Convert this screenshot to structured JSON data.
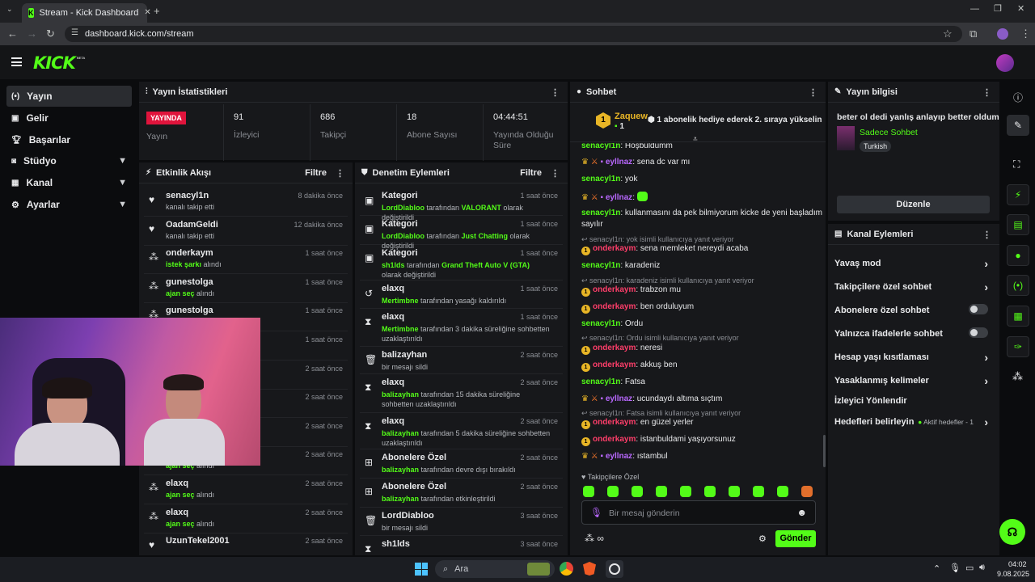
{
  "browser": {
    "tab_title": "Stream - Kick Dashboard",
    "url": "dashboard.kick.com/stream"
  },
  "brand": {
    "logo": "KICK",
    "beta": "BETA",
    "accent": "#53fc18"
  },
  "nav": [
    {
      "label": "Yayın",
      "icon": "broadcast-icon"
    },
    {
      "label": "Gelir",
      "icon": "income-icon"
    },
    {
      "label": "Başarılar",
      "icon": "trophy-icon"
    },
    {
      "label": "Stüdyo",
      "icon": "studio-icon"
    },
    {
      "label": "Kanal",
      "icon": "channel-icon"
    },
    {
      "label": "Ayarlar",
      "icon": "gear-icon"
    }
  ],
  "stats": {
    "title": "Yayın İstatistikleri",
    "live_badge": "YAYINDA",
    "live_label": "Yayın",
    "items": [
      {
        "value": "91",
        "label": "İzleyici"
      },
      {
        "value": "686",
        "label": "Takipçi"
      },
      {
        "value": "18",
        "label": "Abone Sayısı"
      },
      {
        "value": "04:44:51",
        "label": "Yayında Olduğu Süre"
      }
    ]
  },
  "activity": {
    "title": "Etkinlik Akışı",
    "filter": "Filtre",
    "rows": [
      {
        "name": "senacyl1n",
        "pre": "",
        "hl": "",
        "post": "kanalı takip etti",
        "time": "8 dakika önce"
      },
      {
        "name": "OadamGeldi",
        "pre": "",
        "hl": "",
        "post": "kanalı takip etti",
        "time": "12 dakika önce"
      },
      {
        "name": "onderkaym",
        "pre": "",
        "hl": "istek şarkı",
        "post": " alındı",
        "time": "1 saat önce"
      },
      {
        "name": "gunestolga",
        "pre": "",
        "hl": "ajan seç",
        "post": " alındı",
        "time": "1 saat önce"
      },
      {
        "name": "gunestolga",
        "pre": "",
        "hl": "",
        "post": "",
        "time": "1 saat önce"
      },
      {
        "name": "",
        "pre": "",
        "hl": "",
        "post": "",
        "time": "1 saat önce"
      },
      {
        "name": "",
        "pre": "",
        "hl": "",
        "post": "",
        "time": "2 saat önce"
      },
      {
        "name": "",
        "pre": "",
        "hl": "",
        "post": "",
        "time": "2 saat önce"
      },
      {
        "name": "",
        "pre": "",
        "hl": "",
        "post": "",
        "time": "2 saat önce"
      },
      {
        "name": "",
        "pre": "",
        "hl": "ajan seç",
        "post": " alındı",
        "time": "2 saat önce"
      },
      {
        "name": "elaxq",
        "pre": "",
        "hl": "ajan seç",
        "post": " alındı",
        "time": "2 saat önce"
      },
      {
        "name": "elaxq",
        "pre": "",
        "hl": "ajan seç",
        "post": " alındı",
        "time": "2 saat önce"
      },
      {
        "name": "UzunTekel2001",
        "pre": "",
        "hl": "",
        "post": "",
        "time": "2 saat önce"
      }
    ]
  },
  "moderation": {
    "title": "Denetim Eylemleri",
    "filter": "Filtre",
    "rows": [
      {
        "name": "Kategori",
        "u": "LordDiabloo",
        "mid": " tarafından ",
        "hl": "VALORANT",
        "post": " olarak değiştirildi",
        "time": "1 saat önce"
      },
      {
        "name": "Kategori",
        "u": "LordDiabloo",
        "mid": " tarafından ",
        "hl": "Just Chatting",
        "post": " olarak değiştirildi",
        "time": "1 saat önce"
      },
      {
        "name": "Kategori",
        "u": "sh1lds",
        "mid": " tarafından ",
        "hl": "Grand Theft Auto V (GTA)",
        "post": " olarak değiştirildi",
        "time": "1 saat önce"
      },
      {
        "name": "elaxq",
        "u": "Mertimbne",
        "mid": " tarafından yasağı kaldırıldı",
        "hl": "",
        "post": "",
        "time": "1 saat önce"
      },
      {
        "name": "elaxq",
        "u": "Mertimbne",
        "mid": " tarafından 3 dakika süreliğine sohbetten uzaklaştırıldı",
        "hl": "",
        "post": "",
        "time": "1 saat önce"
      },
      {
        "name": "balizayhan",
        "u": "",
        "mid": "bir mesajı sildi",
        "hl": "",
        "post": "",
        "time": "2 saat önce"
      },
      {
        "name": "elaxq",
        "u": "balizayhan",
        "mid": " tarafından 15 dakika süreliğine sohbetten uzaklaştırıldı",
        "hl": "",
        "post": "",
        "time": "2 saat önce"
      },
      {
        "name": "elaxq",
        "u": "balizayhan",
        "mid": " tarafından 5 dakika süreliğine sohbetten uzaklaştırıldı",
        "hl": "",
        "post": "",
        "time": "2 saat önce"
      },
      {
        "name": "Abonelere Özel",
        "u": "balizayhan",
        "mid": " tarafından devre dışı bırakıldı",
        "hl": "",
        "post": "",
        "time": "2 saat önce"
      },
      {
        "name": "Abonelere Özel",
        "u": "balizayhan",
        "mid": " tarafından etkinleştirildi",
        "hl": "",
        "post": "",
        "time": "2 saat önce"
      },
      {
        "name": "LordDiabloo",
        "u": "",
        "mid": "bir mesajı sildi",
        "hl": "",
        "post": "",
        "time": "3 saat önce"
      },
      {
        "name": "sh1lds",
        "u": "",
        "mid": "",
        "hl": "",
        "post": "",
        "time": "3 saat önce"
      }
    ]
  },
  "chat": {
    "title": "Sohbet",
    "pinned_user": "Zaquew",
    "pinned_count": "1",
    "pinned_msg": "1 abonelik hediye ederek 2. sıraya yükselin",
    "lines": [
      {
        "kind": "msg",
        "user": "senacyl1n",
        "color": "g",
        "badges": "",
        "text": ": Hoşbuldumm"
      },
      {
        "kind": "msg",
        "user": "eyllnaz",
        "color": "p",
        "badges": "crown",
        "text": ": sena dc var mı"
      },
      {
        "kind": "msg",
        "user": "senacyl1n",
        "color": "g",
        "badges": "",
        "text": ": yok"
      },
      {
        "kind": "msg",
        "user": "eyllnaz",
        "color": "p",
        "badges": "crown",
        "text": ":"
      },
      {
        "kind": "msg",
        "user": "senacyl1n",
        "color": "g",
        "badges": "",
        "text": ": kullanmasını da pek bilmiyorum kicke de yeni başladım"
      },
      {
        "kind": "cont",
        "text": "sayılır"
      },
      {
        "kind": "reply",
        "text": "senacyl1n: yok isimli kullanıcıya yanıt veriyor"
      },
      {
        "kind": "msg",
        "user": "onderkaym",
        "color": "o",
        "badges": "coin",
        "text": ": sena memleket nereydi acaba"
      },
      {
        "kind": "msg",
        "user": "senacyl1n",
        "color": "g",
        "badges": "",
        "text": ": karadeniz"
      },
      {
        "kind": "reply",
        "text": "senacyl1n: karadeniz isimli kullanıcıya yanıt veriyor"
      },
      {
        "kind": "msg",
        "user": "onderkaym",
        "color": "o",
        "badges": "coin",
        "text": ": trabzon mu"
      },
      {
        "kind": "msg",
        "user": "onderkaym",
        "color": "o",
        "badges": "coin",
        "text": ": ben orduluyum"
      },
      {
        "kind": "msg",
        "user": "senacyl1n",
        "color": "g",
        "badges": "",
        "text": ": Ordu"
      },
      {
        "kind": "reply",
        "text": "senacyl1n: Ordu isimli kullanıcıya yanıt veriyor"
      },
      {
        "kind": "msg",
        "user": "onderkaym",
        "color": "o",
        "badges": "coin",
        "text": ": neresi"
      },
      {
        "kind": "msg",
        "user": "onderkaym",
        "color": "o",
        "badges": "coin",
        "text": ": akkuş ben"
      },
      {
        "kind": "msg",
        "user": "senacyl1n",
        "color": "g",
        "badges": "",
        "text": ": Fatsa"
      },
      {
        "kind": "msg",
        "user": "eyllnaz",
        "color": "p",
        "badges": "crown",
        "text": ": ucundaydı altıma sıçtım"
      },
      {
        "kind": "reply",
        "text": "senacyl1n: Fatsa isimli kullanıcıya yanıt veriyor"
      },
      {
        "kind": "msg",
        "user": "onderkaym",
        "color": "o",
        "badges": "coin",
        "text": ": en güzel yerler"
      },
      {
        "kind": "msg",
        "user": "onderkaym",
        "color": "o",
        "badges": "coin",
        "text": ": istanbuldami yaşıyorsunuz"
      },
      {
        "kind": "msg",
        "user": "eyllnaz",
        "color": "p",
        "badges": "crown",
        "text": ": ıstambul"
      }
    ],
    "emote_section": "Takipçilere Özel",
    "input_placeholder": "Bir mesaj gönderin",
    "send": "Gönder"
  },
  "stream_info": {
    "title": "Yayın bilgisi",
    "stream_title": "beter ol dedi yanlış anlayıp better oldum",
    "category": "Sadece Sohbet",
    "tag": "Turkish",
    "edit": "Düzenle"
  },
  "channel_actions": {
    "title": "Kanal Eylemleri",
    "items": [
      {
        "label": "Yavaş mod",
        "ctrl": "arrow"
      },
      {
        "label": "Takipçilere özel sohbet",
        "ctrl": "arrow"
      },
      {
        "label": "Abonelere özel sohbet",
        "ctrl": "toggle"
      },
      {
        "label": "Yalnızca ifadelerle sohbet",
        "ctrl": "toggle"
      },
      {
        "label": "Hesap yaşı kısıtlaması",
        "ctrl": "arrow"
      },
      {
        "label": "Yasaklanmış kelimeler",
        "ctrl": "arrow"
      },
      {
        "label": "İzleyici Yönlendir",
        "ctrl": "none"
      },
      {
        "label": "Hedefleri belirleyin",
        "ctrl": "arrow"
      }
    ],
    "goals_status": "Aktif hedefler - 1"
  },
  "taskbar": {
    "search": "Ara",
    "time": "04:02",
    "date": "9.08.2025"
  }
}
